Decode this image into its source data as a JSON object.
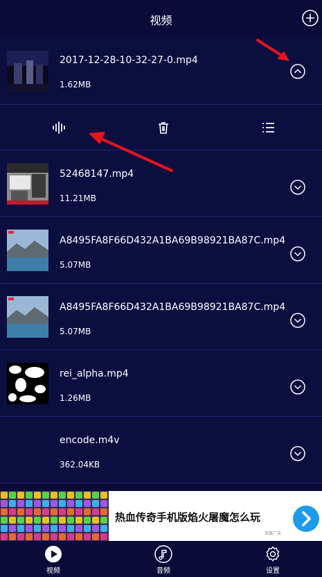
{
  "header": {
    "title": "视频"
  },
  "items": [
    {
      "name": "2017-12-28-10-32-27-0.mp4",
      "size": "1.62MB",
      "expanded": true
    },
    {
      "name": "52468147.mp4",
      "size": "11.21MB",
      "expanded": false
    },
    {
      "name": "A8495FA8F66D432A1BA69B98921BA87C.mp4",
      "size": "5.07MB",
      "expanded": false
    },
    {
      "name": "A8495FA8F66D432A1BA69B98921BA87C.mp4",
      "size": "5.07MB",
      "expanded": false
    },
    {
      "name": "rei_alpha.mp4",
      "size": "1.26MB",
      "expanded": false
    },
    {
      "name": "encode.m4v",
      "size": "362.04KB",
      "expanded": false
    }
  ],
  "ad": {
    "text": "热血传奇手机版焰火屠魔怎么玩",
    "tag": "百度广告"
  },
  "tabs": [
    {
      "label": "视频",
      "icon": "play-circle-icon",
      "active": true
    },
    {
      "label": "音频",
      "icon": "music-note-icon",
      "active": false
    },
    {
      "label": "设置",
      "icon": "gear-icon",
      "active": false
    }
  ],
  "colors": {
    "background": "#0b0b3a",
    "divider": "#1f2470",
    "annotation": "#e8141c",
    "ad_button": "#1e9be8"
  }
}
